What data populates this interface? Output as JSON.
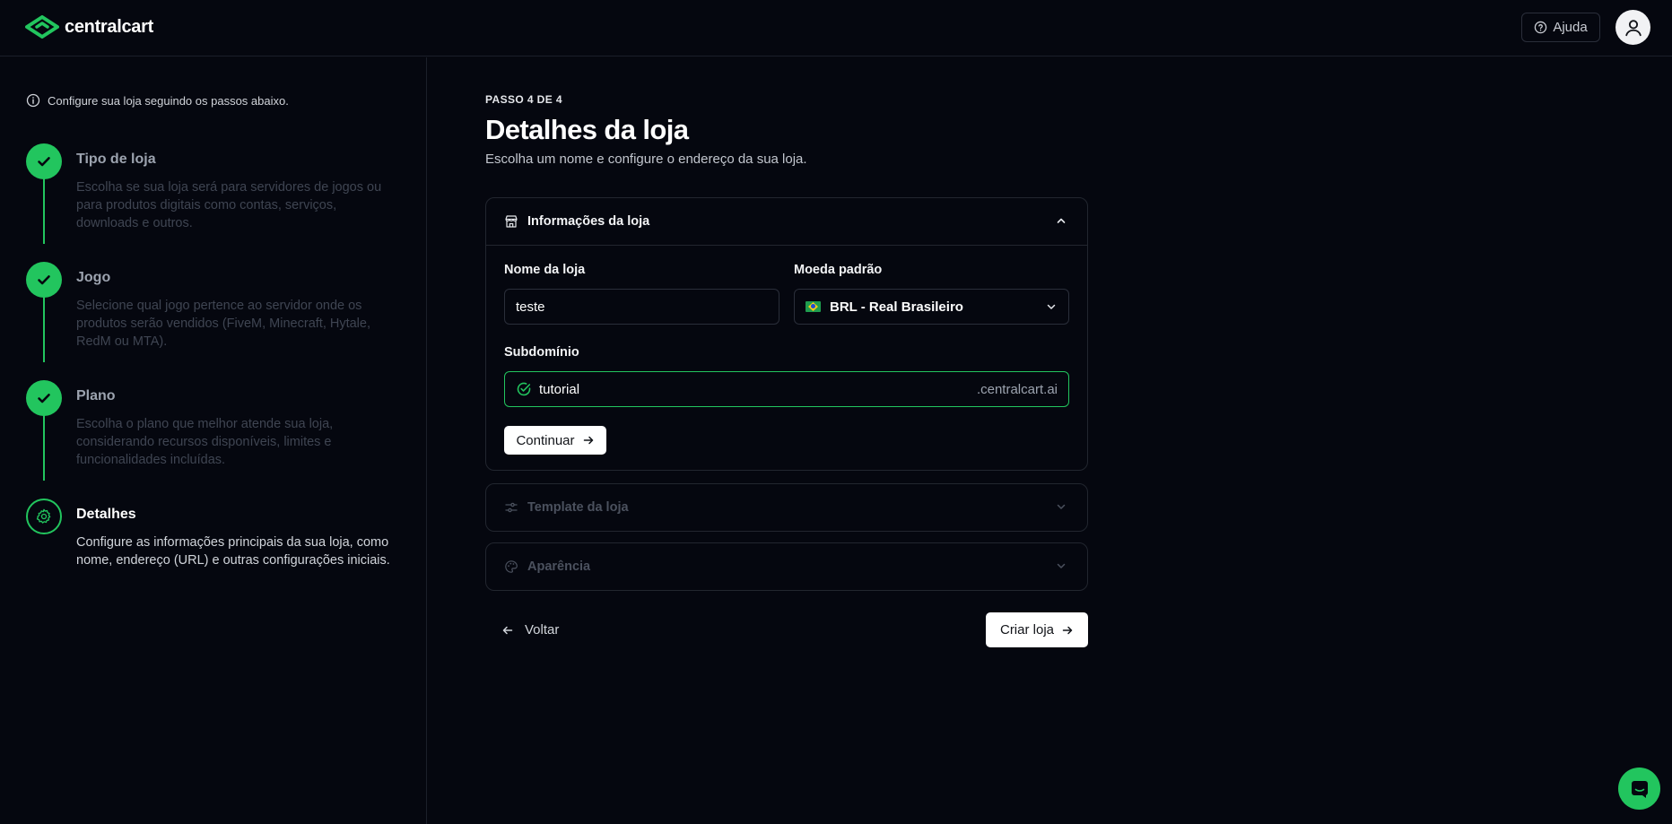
{
  "header": {
    "logo_text": "centralcart",
    "help_label": "Ajuda",
    "brand_color": "#22c55e"
  },
  "sidebar": {
    "info_text": "Configure sua loja seguindo os passos abaixo.",
    "steps": [
      {
        "title": "Tipo de loja",
        "description": "Escolha se sua loja será para servidores de jogos ou para produtos digitais como contas, serviços, downloads e outros.",
        "status": "completed"
      },
      {
        "title": "Jogo",
        "description": "Selecione qual jogo pertence ao servidor onde os produtos serão vendidos (FiveM, Minecraft, Hytale, RedM ou MTA).",
        "status": "completed"
      },
      {
        "title": "Plano",
        "description": "Escolha o plano que melhor atende sua loja, considerando recursos disponíveis, limites e funcionalidades incluídas.",
        "status": "completed"
      },
      {
        "title": "Detalhes",
        "description": "Configure as informações principais da sua loja, como nome, endereço (URL) e outras configurações iniciais.",
        "status": "active"
      }
    ]
  },
  "main": {
    "kicker": "PASSO 4 DE 4",
    "title": "Detalhes da loja",
    "subtitle": "Escolha um nome e configure o endereço da sua loja.",
    "sections": {
      "info": {
        "title": "Informações da loja",
        "store_name_label": "Nome da loja",
        "store_name_value": "teste",
        "currency_label": "Moeda padrão",
        "currency_value": "BRL - Real Brasileiro",
        "subdomain_label": "Subdomínio",
        "subdomain_value": "tutorial",
        "subdomain_suffix": ".centralcart.ai",
        "continue_label": "Continuar"
      },
      "template": {
        "title": "Template da loja"
      },
      "appearance": {
        "title": "Aparência"
      }
    },
    "back_label": "Voltar",
    "create_label": "Criar loja"
  }
}
